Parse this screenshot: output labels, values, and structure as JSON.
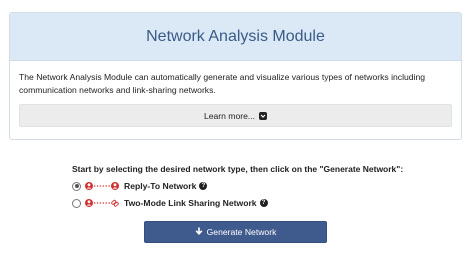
{
  "panel": {
    "title": "Network Analysis Module",
    "description": "The Network Analysis Module can automatically generate and visualize various types of networks including communication networks and link-sharing networks.",
    "learn_more_label": "Learn more..."
  },
  "network_selection": {
    "prompt": "Start by selecting the desired network type, then click on the \"Generate Network\":",
    "options": [
      {
        "label": "Reply-To Network",
        "selected": true,
        "icon": "user-user-network-icon"
      },
      {
        "label": "Two-Mode Link Sharing Network",
        "selected": false,
        "icon": "user-link-network-icon"
      }
    ]
  },
  "generate_button": {
    "label": "Generate Network",
    "icon": "arrow-down-icon"
  },
  "colors": {
    "header_bg": "#dbe9f6",
    "title": "#3a5b86",
    "button": "#3f5b8e",
    "user_icon": "#d23030"
  }
}
